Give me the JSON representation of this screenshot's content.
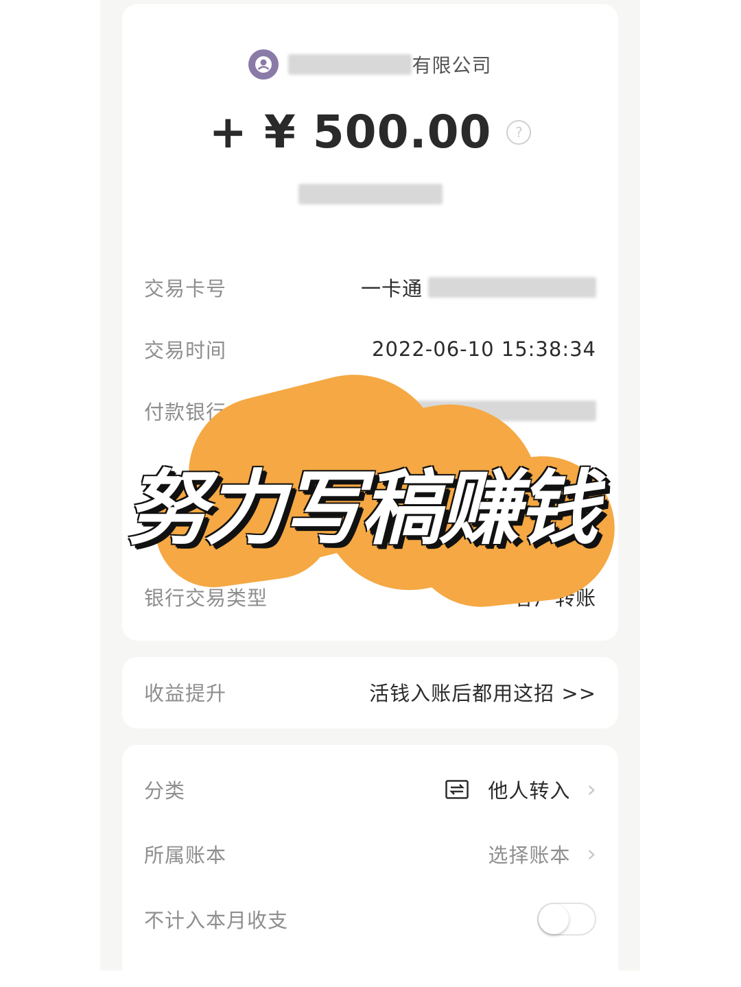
{
  "payer": {
    "name_visible": "有限公司"
  },
  "amount": {
    "text": "+ ¥ 500.00",
    "help_glyph": "?"
  },
  "details": {
    "card_label": "交易卡号",
    "card_value": "一卡通",
    "time_label": "交易时间",
    "time_value": "2022-06-10 15:38:34",
    "bank_label": "付款银行",
    "type_label": "银行交易类型",
    "type_value": "客户转账"
  },
  "promo": {
    "label": "收益提升",
    "value": "活钱入账后都用这招 >>"
  },
  "settings": {
    "category_label": "分类",
    "category_value": "他人转入",
    "ledger_label": "所属账本",
    "ledger_value": "选择账本",
    "exclude_label": "不计入本月收支",
    "exclude_on": false
  },
  "overlay_text": "努力写稿赚钱",
  "colors": {
    "accent_orange": "#f5a843",
    "avatar": "#8a7aa8"
  },
  "icons": [
    "user-avatar-icon",
    "help-icon",
    "transfer-icon",
    "chevron-right-icon"
  ]
}
